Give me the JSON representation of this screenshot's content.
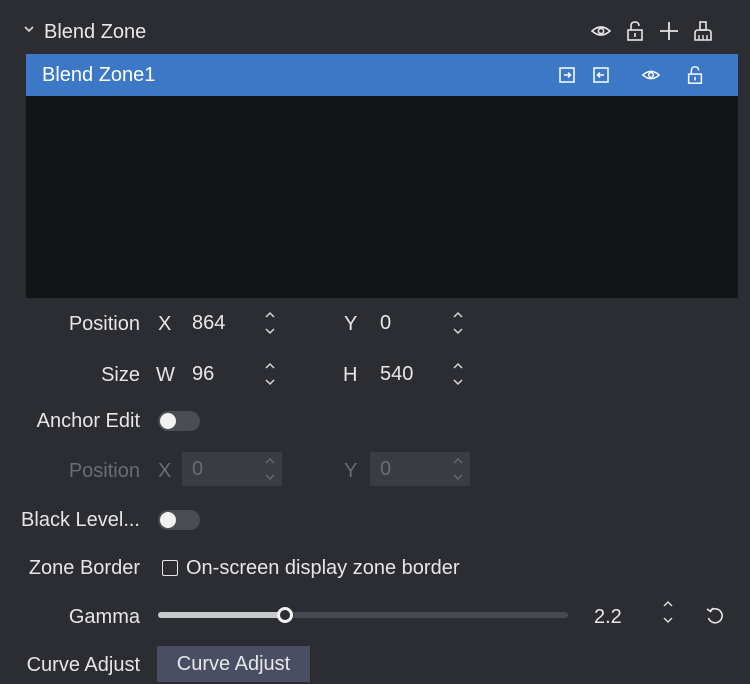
{
  "panel": {
    "title": "Blend Zone",
    "header_icons": [
      "eye-icon",
      "unlock-icon",
      "plus-icon",
      "clean-brush-icon"
    ]
  },
  "zone_list": {
    "items": [
      {
        "label": "Blend Zone1",
        "icons": [
          "export-icon",
          "import-icon",
          "eye-icon",
          "unlock-icon"
        ]
      }
    ]
  },
  "fields": {
    "position": {
      "label": "Position",
      "x_axis": "X",
      "x_value": "864",
      "y_axis": "Y",
      "y_value": "0"
    },
    "size": {
      "label": "Size",
      "w_axis": "W",
      "w_value": "96",
      "h_axis": "H",
      "h_value": "540"
    },
    "anchor_edit": {
      "label": "Anchor Edit",
      "on": false
    },
    "anchor_position": {
      "label": "Position",
      "x_axis": "X",
      "x_value": "0",
      "y_axis": "Y",
      "y_value": "0",
      "disabled": true
    },
    "black_level": {
      "label": "Black Level...",
      "on": false
    },
    "zone_border": {
      "label": "Zone Border",
      "checkbox_label": "On-screen display zone border",
      "checked": false
    },
    "gamma": {
      "label": "Gamma",
      "value": "2.2",
      "slider_fraction": 0.31
    },
    "curve_adjust": {
      "label": "Curve Adjust",
      "button_label": "Curve Adjust"
    }
  },
  "colors": {
    "background": "#2b2d33",
    "selection": "#3d78c6",
    "list_bg": "#131417",
    "button": "#4a4e63"
  }
}
